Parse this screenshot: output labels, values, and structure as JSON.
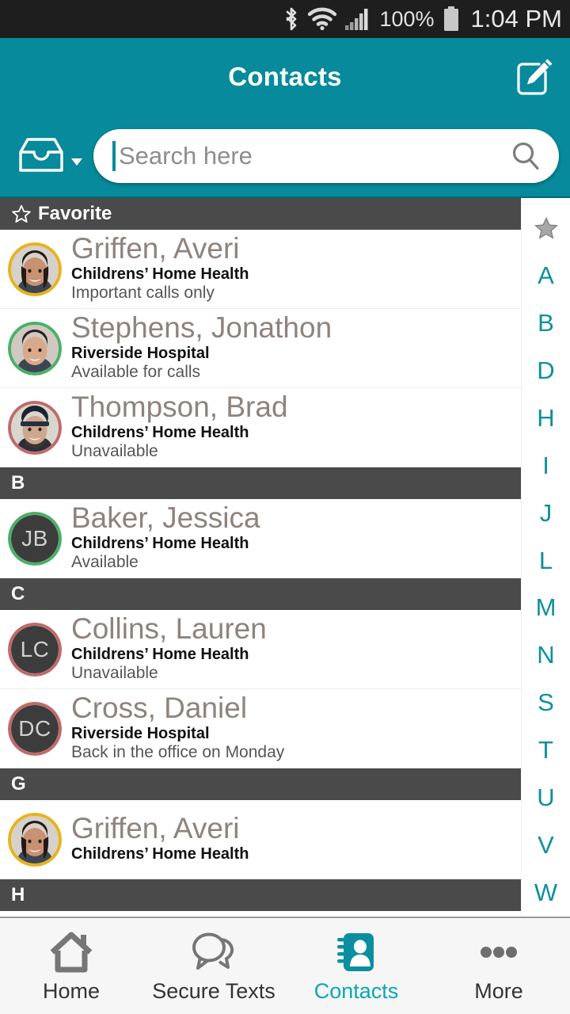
{
  "status_bar": {
    "bluetooth_icon": "bluetooth-icon",
    "wifi_icon": "wifi-icon",
    "signal_icon": "cellular-signal-icon",
    "battery_percent": "100%",
    "battery_icon": "battery-full-icon",
    "time": "1:04 PM"
  },
  "app_bar": {
    "title": "Contacts",
    "edit_icon": "edit-compose-icon"
  },
  "search": {
    "inbox_icon": "inbox-tray-icon",
    "dropdown_icon": "chevron-down-icon",
    "placeholder": "Search here",
    "value": "",
    "search_icon": "search-icon"
  },
  "colors": {
    "accent_teal": "#078a9b",
    "index_teal": "#0f8f9e",
    "active_nav_teal": "#09a6bb",
    "section_gray": "#4a4a4a",
    "name_gray": "#8e837d",
    "status_ring_available": "#4caf68",
    "status_ring_busy": "#c06a6a",
    "status_ring_important": "#e6b31e",
    "avatar_fill": "#3c3c3c"
  },
  "sections": [
    {
      "label": "Favorite",
      "icon": "star-outline-icon",
      "contacts": [
        {
          "name": "Griffen, Averi",
          "org": "Childrens’ Home Health",
          "status": "Important calls only",
          "avatar_type": "photo",
          "photo_subject": "smiling-woman-dark-hair",
          "ring_color": "#e6b31e"
        },
        {
          "name": "Stephens, Jonathon",
          "org": "Riverside Hospital",
          "status": "Available for calls",
          "avatar_type": "photo",
          "photo_subject": "smiling-man-short-hair",
          "ring_color": "#4caf68"
        },
        {
          "name": "Thompson, Brad",
          "org": "Childrens’ Home Health",
          "status": "Unavailable",
          "avatar_type": "photo",
          "photo_subject": "bearded-man-beanie",
          "ring_color": "#c06a6a"
        }
      ]
    },
    {
      "label": "B",
      "icon": "",
      "contacts": [
        {
          "name": "Baker, Jessica",
          "org": "Childrens’ Home Health",
          "status": "Available",
          "avatar_type": "initials",
          "initials": "JB",
          "ring_color": "#4caf68"
        }
      ]
    },
    {
      "label": "C",
      "icon": "",
      "contacts": [
        {
          "name": "Collins, Lauren",
          "org": "Childrens’ Home Health",
          "status": "Unavailable",
          "avatar_type": "initials",
          "initials": "LC",
          "ring_color": "#c06a6a"
        },
        {
          "name": "Cross, Daniel",
          "org": "Riverside Hospital",
          "status": "Back in the office on Monday",
          "avatar_type": "initials",
          "initials": "DC",
          "ring_color": "#c06a6a"
        }
      ]
    },
    {
      "label": "G",
      "icon": "",
      "contacts": [
        {
          "name": "Griffen, Averi",
          "org": "Childrens’ Home Health",
          "status": "",
          "avatar_type": "photo",
          "photo_subject": "smiling-woman-dark-hair",
          "ring_color": "#e6b31e"
        }
      ]
    },
    {
      "label": "H",
      "icon": "",
      "contacts": []
    }
  ],
  "alpha_index": [
    {
      "label": "★",
      "name": "favorite"
    },
    {
      "label": "A",
      "name": "a"
    },
    {
      "label": "B",
      "name": "b"
    },
    {
      "label": "D",
      "name": "d"
    },
    {
      "label": "H",
      "name": "h"
    },
    {
      "label": "I",
      "name": "i"
    },
    {
      "label": "J",
      "name": "j"
    },
    {
      "label": "L",
      "name": "l"
    },
    {
      "label": "M",
      "name": "m"
    },
    {
      "label": "N",
      "name": "n"
    },
    {
      "label": "S",
      "name": "s"
    },
    {
      "label": "T",
      "name": "t"
    },
    {
      "label": "U",
      "name": "u"
    },
    {
      "label": "V",
      "name": "v"
    },
    {
      "label": "W",
      "name": "w"
    }
  ],
  "bottom_nav": [
    {
      "label": "Home",
      "icon": "home-icon",
      "active": false
    },
    {
      "label": "Secure Texts",
      "icon": "chat-bubbles-icon",
      "active": false
    },
    {
      "label": "Contacts",
      "icon": "address-book-icon",
      "active": true
    },
    {
      "label": "More",
      "icon": "ellipsis-icon",
      "active": false
    }
  ]
}
